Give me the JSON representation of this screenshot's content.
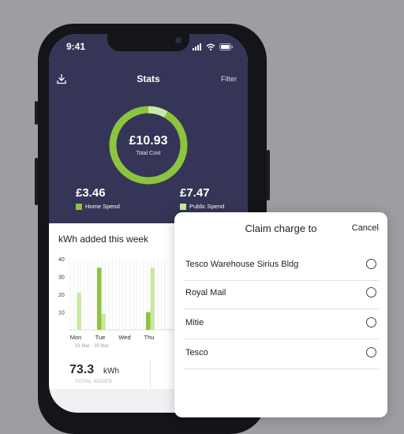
{
  "status_bar": {
    "time": "9:41"
  },
  "header": {
    "title": "Stats",
    "filter_label": "Filter"
  },
  "summary": {
    "total_cost": "£10.93",
    "total_cost_label": "Total Cost",
    "home_spend": "£3.46",
    "home_spend_label": "Home Spend",
    "public_spend": "£7.47",
    "public_spend_label": "Public Spend",
    "home_fraction": 0.317,
    "public_fraction": 0.683
  },
  "colors": {
    "home": "#8cc43f",
    "public": "#c9e9a0",
    "header_bg": "#353557"
  },
  "weekly": {
    "title": "kWh added this week",
    "date_range": "23 Mar - 29 Mar",
    "total_value": "73.3",
    "total_unit": "kWh",
    "total_label": "TOTAL ADDED"
  },
  "chart_data": {
    "type": "bar",
    "categories": [
      "Mon",
      "Tue",
      "Wed",
      "Thu"
    ],
    "series": [
      {
        "name": "Home Spend",
        "values": [
          0,
          35,
          0,
          10
        ]
      },
      {
        "name": "Public Spend",
        "values": [
          21,
          9,
          0,
          35
        ]
      }
    ],
    "yticks": [
      10,
      20,
      30,
      40
    ],
    "ylim": [
      0,
      40
    ]
  },
  "claim_sheet": {
    "title": "Claim charge to",
    "cancel_label": "Cancel",
    "options": [
      "Tesco Warehouse Sirius Bldg",
      "Royal Mail",
      "Mitie",
      "Tesco"
    ]
  }
}
